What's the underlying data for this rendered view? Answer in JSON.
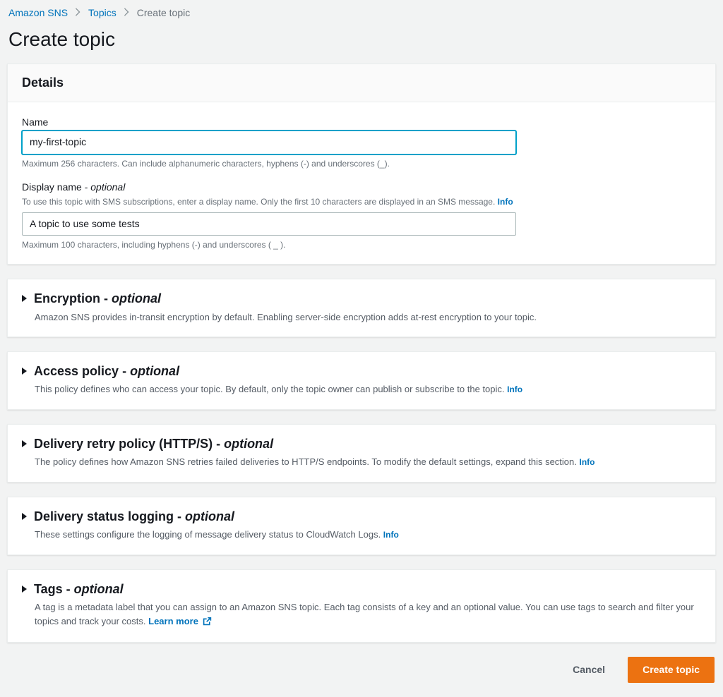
{
  "breadcrumb": {
    "root": "Amazon SNS",
    "topics": "Topics",
    "current": "Create topic"
  },
  "page_title": "Create topic",
  "details": {
    "heading": "Details",
    "name": {
      "label": "Name",
      "value": "my-first-topic",
      "help": "Maximum 256 characters. Can include alphanumeric characters, hyphens (-) and underscores (_)."
    },
    "display_name": {
      "label_main": "Display name - ",
      "label_optional": "optional",
      "sub": "To use this topic with SMS subscriptions, enter a display name. Only the first 10 characters are displayed in an SMS message. ",
      "info": "Info",
      "value": "A topic to use some tests",
      "help": "Maximum 100 characters, including hyphens (-) and underscores ( _ )."
    }
  },
  "sections": {
    "encryption": {
      "title_main": "Encryption - ",
      "title_optional": "optional",
      "desc": "Amazon SNS provides in-transit encryption by default. Enabling server-side encryption adds at-rest encryption to your topic."
    },
    "access_policy": {
      "title_main": "Access policy - ",
      "title_optional": "optional",
      "desc": "This policy defines who can access your topic. By default, only the topic owner can publish or subscribe to the topic. ",
      "info": "Info"
    },
    "retry_policy": {
      "title_main": "Delivery retry policy (HTTP/S) - ",
      "title_optional": "optional",
      "desc": "The policy defines how Amazon SNS retries failed deliveries to HTTP/S endpoints. To modify the default settings, expand this section. ",
      "info": "Info"
    },
    "status_logging": {
      "title_main": "Delivery status logging - ",
      "title_optional": "optional",
      "desc": "These settings configure the logging of message delivery status to CloudWatch Logs. ",
      "info": "Info"
    },
    "tags": {
      "title_main": "Tags - ",
      "title_optional": "optional",
      "desc": "A tag is a metadata label that you can assign to an Amazon SNS topic. Each tag consists of a key and an optional value. You can use tags to search and filter your topics and track your costs. ",
      "learn": "Learn more"
    }
  },
  "footer": {
    "cancel": "Cancel",
    "create": "Create topic"
  }
}
